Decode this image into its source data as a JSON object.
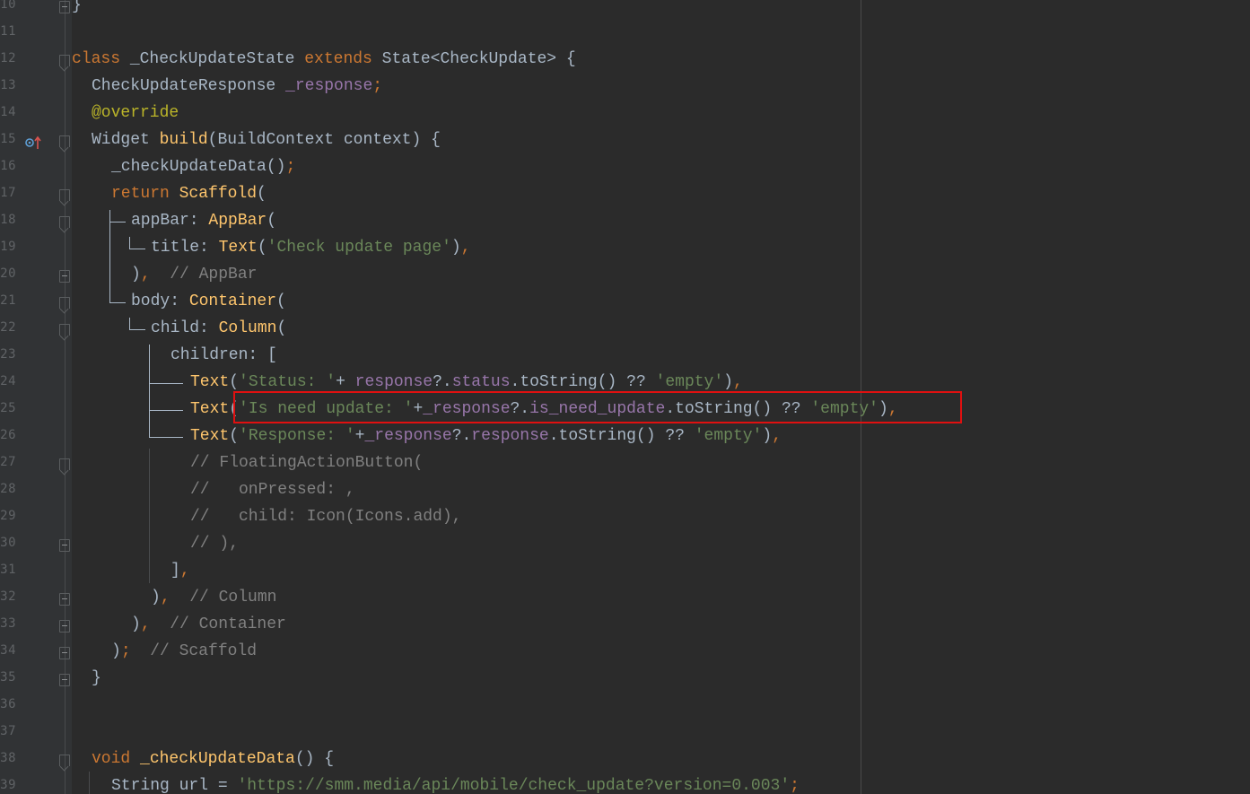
{
  "editor": {
    "lines": [
      {
        "num": "10",
        "tokens": [
          {
            "t": "}",
            "c": "plain"
          }
        ]
      },
      {
        "num": "11",
        "tokens": []
      },
      {
        "num": "12",
        "tokens": [
          {
            "t": "class ",
            "c": "kw"
          },
          {
            "t": "_CheckUpdateState ",
            "c": "cls"
          },
          {
            "t": "extends ",
            "c": "kw"
          },
          {
            "t": "State<CheckUpdate> {",
            "c": "cls"
          }
        ]
      },
      {
        "num": "13",
        "tokens": [
          {
            "t": "CheckUpdateResponse ",
            "c": "cls"
          },
          {
            "t": "_response",
            "c": "fld"
          },
          {
            "t": ";",
            "c": "kw"
          }
        ]
      },
      {
        "num": "14",
        "tokens": [
          {
            "t": "@override",
            "c": "ann"
          }
        ]
      },
      {
        "num": "15",
        "tokens": [
          {
            "t": "Widget ",
            "c": "cls"
          },
          {
            "t": "build",
            "c": "fn"
          },
          {
            "t": "(BuildContext context) {",
            "c": "plain"
          }
        ]
      },
      {
        "num": "16",
        "tokens": [
          {
            "t": "_checkUpdateData()",
            "c": "plain"
          },
          {
            "t": ";",
            "c": "kw"
          }
        ]
      },
      {
        "num": "17",
        "tokens": [
          {
            "t": "return ",
            "c": "kw"
          },
          {
            "t": "Scaffold",
            "c": "fn"
          },
          {
            "t": "(",
            "c": "plain"
          }
        ]
      },
      {
        "num": "18",
        "tokens": [
          {
            "t": "appBar: ",
            "c": "plain"
          },
          {
            "t": "AppBar",
            "c": "fn"
          },
          {
            "t": "(",
            "c": "plain"
          }
        ]
      },
      {
        "num": "19",
        "tokens": [
          {
            "t": "title: ",
            "c": "plain"
          },
          {
            "t": "Text",
            "c": "fn"
          },
          {
            "t": "(",
            "c": "plain"
          },
          {
            "t": "'Check update page'",
            "c": "str"
          },
          {
            "t": ")",
            "c": "plain"
          },
          {
            "t": ",",
            "c": "kw"
          }
        ]
      },
      {
        "num": "20",
        "tokens": [
          {
            "t": ")",
            "c": "plain"
          },
          {
            "t": ",  ",
            "c": "kw"
          },
          {
            "t": "// AppBar",
            "c": "cmt"
          }
        ]
      },
      {
        "num": "21",
        "tokens": [
          {
            "t": "body: ",
            "c": "plain"
          },
          {
            "t": "Container",
            "c": "fn"
          },
          {
            "t": "(",
            "c": "plain"
          }
        ]
      },
      {
        "num": "22",
        "tokens": [
          {
            "t": "child: ",
            "c": "plain"
          },
          {
            "t": "Column",
            "c": "fn"
          },
          {
            "t": "(",
            "c": "plain"
          }
        ]
      },
      {
        "num": "23",
        "tokens": [
          {
            "t": "children: [",
            "c": "plain"
          }
        ]
      },
      {
        "num": "24",
        "tokens": [
          {
            "t": "Text",
            "c": "fn"
          },
          {
            "t": "(",
            "c": "plain"
          },
          {
            "t": "'Status: '",
            "c": "str"
          },
          {
            "t": "+ ",
            "c": "plain"
          },
          {
            "t": "response",
            "c": "fld"
          },
          {
            "t": "?.",
            "c": "plain"
          },
          {
            "t": "status",
            "c": "fld"
          },
          {
            "t": ".toString() ?? ",
            "c": "plain"
          },
          {
            "t": "'empty'",
            "c": "str"
          },
          {
            "t": ")",
            "c": "plain"
          },
          {
            "t": ",",
            "c": "kw"
          }
        ]
      },
      {
        "num": "25",
        "tokens": [
          {
            "t": "Text",
            "c": "fn"
          },
          {
            "t": "(",
            "c": "plain"
          },
          {
            "t": "'Is need update: '",
            "c": "str"
          },
          {
            "t": "+",
            "c": "plain"
          },
          {
            "t": "_response",
            "c": "fld"
          },
          {
            "t": "?.",
            "c": "plain"
          },
          {
            "t": "is_need_update",
            "c": "fld"
          },
          {
            "t": ".toString() ?? ",
            "c": "plain"
          },
          {
            "t": "'empty'",
            "c": "str"
          },
          {
            "t": ")",
            "c": "plain"
          },
          {
            "t": ",",
            "c": "kw"
          }
        ]
      },
      {
        "num": "26",
        "tokens": [
          {
            "t": "Text",
            "c": "fn"
          },
          {
            "t": "(",
            "c": "plain"
          },
          {
            "t": "'Response: '",
            "c": "str"
          },
          {
            "t": "+",
            "c": "plain"
          },
          {
            "t": "_response",
            "c": "fld"
          },
          {
            "t": "?.",
            "c": "plain"
          },
          {
            "t": "response",
            "c": "fld"
          },
          {
            "t": ".toString() ?? ",
            "c": "plain"
          },
          {
            "t": "'empty'",
            "c": "str"
          },
          {
            "t": ")",
            "c": "plain"
          },
          {
            "t": ",",
            "c": "kw"
          }
        ]
      },
      {
        "num": "27",
        "tokens": [
          {
            "t": "// FloatingActionButton(",
            "c": "cmt"
          }
        ]
      },
      {
        "num": "28",
        "tokens": [
          {
            "t": "//   onPressed: ,",
            "c": "cmt"
          }
        ]
      },
      {
        "num": "29",
        "tokens": [
          {
            "t": "//   child: Icon(Icons.add),",
            "c": "cmt"
          }
        ]
      },
      {
        "num": "30",
        "tokens": [
          {
            "t": "// ),",
            "c": "cmt"
          }
        ]
      },
      {
        "num": "31",
        "tokens": [
          {
            "t": "]",
            "c": "plain"
          },
          {
            "t": ",",
            "c": "kw"
          }
        ]
      },
      {
        "num": "32",
        "tokens": [
          {
            "t": ")",
            "c": "plain"
          },
          {
            "t": ",  ",
            "c": "kw"
          },
          {
            "t": "// Column",
            "c": "cmt"
          }
        ]
      },
      {
        "num": "33",
        "tokens": [
          {
            "t": ")",
            "c": "plain"
          },
          {
            "t": ",  ",
            "c": "kw"
          },
          {
            "t": "// Container",
            "c": "cmt"
          }
        ]
      },
      {
        "num": "34",
        "tokens": [
          {
            "t": ")",
            "c": "plain"
          },
          {
            "t": ";  ",
            "c": "kw"
          },
          {
            "t": "// Scaffold",
            "c": "cmt"
          }
        ]
      },
      {
        "num": "35",
        "tokens": [
          {
            "t": "}",
            "c": "plain"
          }
        ]
      },
      {
        "num": "36",
        "tokens": []
      },
      {
        "num": "37",
        "tokens": []
      },
      {
        "num": "38",
        "tokens": [
          {
            "t": "void ",
            "c": "kw"
          },
          {
            "t": "_checkUpdateData",
            "c": "fn"
          },
          {
            "t": "() {",
            "c": "plain"
          }
        ]
      },
      {
        "num": "39",
        "tokens": [
          {
            "t": "String url = ",
            "c": "plain"
          },
          {
            "t": "'https://smm.media/api/mobile/check_update?version=0.003'",
            "c": "str"
          },
          {
            "t": ";",
            "c": "kw"
          }
        ]
      }
    ]
  },
  "colors": {
    "background": "#2b2b2b",
    "keyword": "#cc7832",
    "function": "#ffc66d",
    "string": "#6a8759",
    "comment": "#808080",
    "annotation": "#bbb529",
    "field": "#9876aa",
    "text": "#a9b7c6",
    "highlight_border": "#e01010"
  },
  "icons": {
    "override_marker": "override-up-arrow-icon",
    "fold_marker": "fold-icon"
  }
}
